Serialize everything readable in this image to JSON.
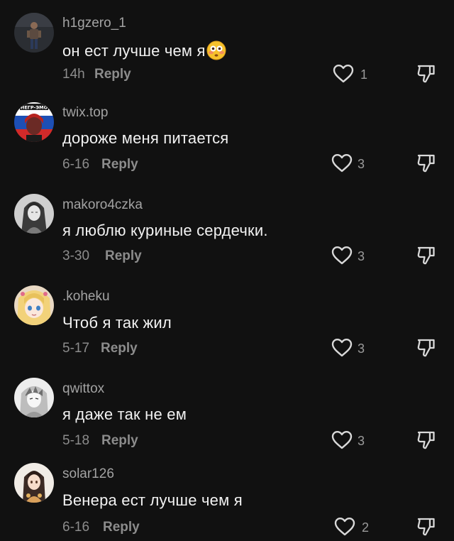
{
  "comments": [
    {
      "username": "h1gzero_1",
      "text": "он ест лучше чем я",
      "emoji": "flushed-face-emoji",
      "time": "14h",
      "reply_label": "Reply",
      "likes": "1",
      "avatar": "avatar-person-dark"
    },
    {
      "username": "twix.top",
      "text": "дороже меня питается",
      "time": "6-16",
      "reply_label": "Reply",
      "likes": "3",
      "avatar": "avatar-flag-person",
      "avatar_banner": "НЕГР-ЭМО"
    },
    {
      "username": "makoro4czka",
      "text": "я люблю куриные сердечки.",
      "time": "3-30",
      "reply_label": "Reply",
      "likes": "3",
      "avatar": "avatar-anime-sketch"
    },
    {
      "username": ".koheku",
      "text": "Чтоб я так жил",
      "time": "5-17",
      "reply_label": "Reply",
      "likes": "3",
      "avatar": "avatar-anime-blonde"
    },
    {
      "username": "qwittox",
      "text": "я даже так не ем",
      "time": "5-18",
      "reply_label": "Reply",
      "likes": "3",
      "avatar": "avatar-manga-sketch"
    },
    {
      "username": "solar126",
      "text": "Венера ест лучше чем я",
      "time": "6-16",
      "reply_label": "Reply",
      "likes": "2",
      "avatar": "avatar-anime-girl"
    }
  ],
  "icons": {
    "like": "heart-outline-icon",
    "dislike": "thumbs-down-outline-icon"
  },
  "colors": {
    "background": "#111111",
    "username": "#a3a3a3",
    "comment_text": "#f2f2f2",
    "meta": "#8c8c8c"
  }
}
